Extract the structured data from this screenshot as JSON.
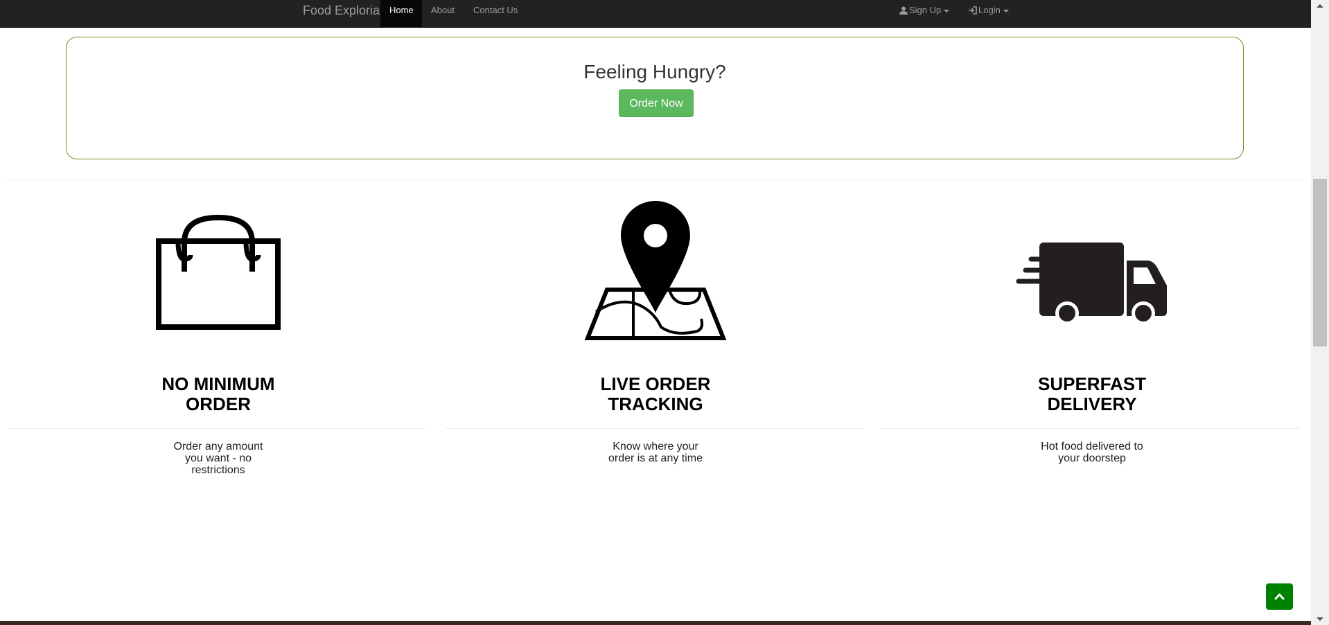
{
  "navbar": {
    "brand": "Food Exploria",
    "links": [
      "Home",
      "About",
      "Contact Us"
    ],
    "active": "Home",
    "signup_label": "Sign Up",
    "login_label": "Login"
  },
  "hero": {
    "title": "Feeling Hungry?",
    "button_label": "Order Now"
  },
  "features": [
    {
      "icon": "shopping-bag-icon",
      "title_lines": [
        "NO MINIMUM",
        "ORDER"
      ],
      "desc_lines": [
        "Order any amount",
        "you want - no",
        "restrictions"
      ]
    },
    {
      "icon": "map-pin-icon",
      "title_lines": [
        "LIVE ORDER",
        "TRACKING"
      ],
      "desc_lines": [
        "Know where your",
        "order is at any time"
      ]
    },
    {
      "icon": "delivery-truck-icon",
      "title_lines": [
        "SUPERFAST",
        "DELIVERY"
      ],
      "desc_lines": [
        "Hot food delivered to",
        "your doorstep"
      ]
    }
  ],
  "colors": {
    "navbar_bg": "#222222",
    "nav_active_bg": "#080808",
    "hero_border": "#6b8e23",
    "order_button": "#5cb85c",
    "back_to_top": "#008000"
  },
  "back_to_top_icon": "chevron-up-icon"
}
